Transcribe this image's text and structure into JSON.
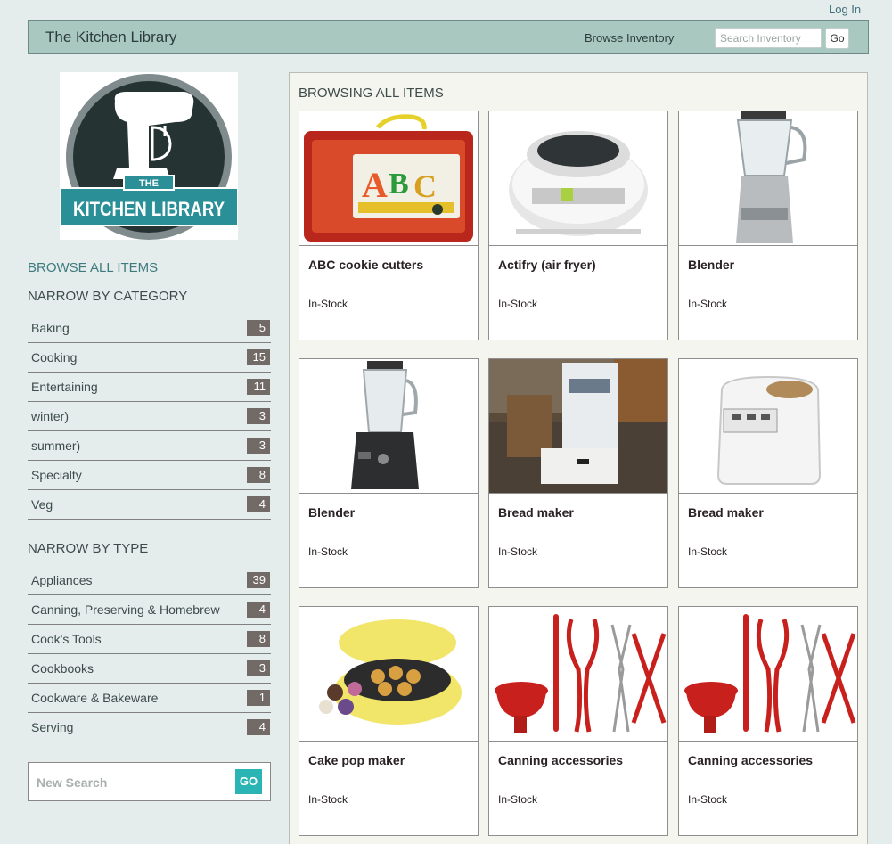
{
  "header": {
    "login_label": "Log In",
    "brand": "The Kitchen Library",
    "browse_label": "Browse Inventory",
    "search_placeholder": "Search Inventory",
    "go_label": "Go"
  },
  "sidebar": {
    "logo_text_the": "THE",
    "logo_text_name": "KITCHEN LIBRARY",
    "browse_all": "BROWSE ALL ITEMS",
    "category_heading": "NARROW BY CATEGORY",
    "categories": [
      {
        "label": "Baking",
        "count": "5"
      },
      {
        "label": "Cooking",
        "count": "15"
      },
      {
        "label": "Entertaining",
        "count": "11"
      },
      {
        "label": "winter)",
        "count": "3"
      },
      {
        "label": "summer)",
        "count": "3"
      },
      {
        "label": "Specialty",
        "count": "8"
      },
      {
        "label": "Veg",
        "count": "4"
      }
    ],
    "type_heading": "NARROW BY TYPE",
    "types": [
      {
        "label": "Appliances",
        "count": "39"
      },
      {
        "label": "Canning, Preserving & Homebrew",
        "count": "4"
      },
      {
        "label": "Cook's Tools",
        "count": "8"
      },
      {
        "label": "Cookbooks",
        "count": "3"
      },
      {
        "label": "Cookware & Bakeware",
        "count": "1"
      },
      {
        "label": "Serving",
        "count": "4"
      }
    ],
    "new_search_placeholder": "New Search",
    "new_search_go": "GO"
  },
  "main": {
    "title": "BROWSING ALL ITEMS",
    "items": [
      {
        "name": "ABC cookie cutters",
        "status": "In-Stock",
        "image": "lunchbox"
      },
      {
        "name": "Actifry (air fryer)",
        "status": "In-Stock",
        "image": "airfryer"
      },
      {
        "name": "Blender",
        "status": "In-Stock",
        "image": "blender-glass"
      },
      {
        "name": "Blender",
        "status": "In-Stock",
        "image": "blender-black"
      },
      {
        "name": "Bread maker",
        "status": "In-Stock",
        "image": "breadmaker-photo"
      },
      {
        "name": "Bread maker",
        "status": "In-Stock",
        "image": "breadmaker-white"
      },
      {
        "name": "Cake pop maker",
        "status": "In-Stock",
        "image": "cakepop"
      },
      {
        "name": "Canning accessories",
        "status": "In-Stock",
        "image": "canning"
      },
      {
        "name": "Canning accessories",
        "status": "In-Stock",
        "image": "canning"
      }
    ]
  },
  "colors": {
    "page_bg": "#e4ecec",
    "topbar_bg": "#a8c8c0",
    "count_badge": "#726a66",
    "accent_teal": "#2bb4b4",
    "link": "#3e7a7e"
  }
}
